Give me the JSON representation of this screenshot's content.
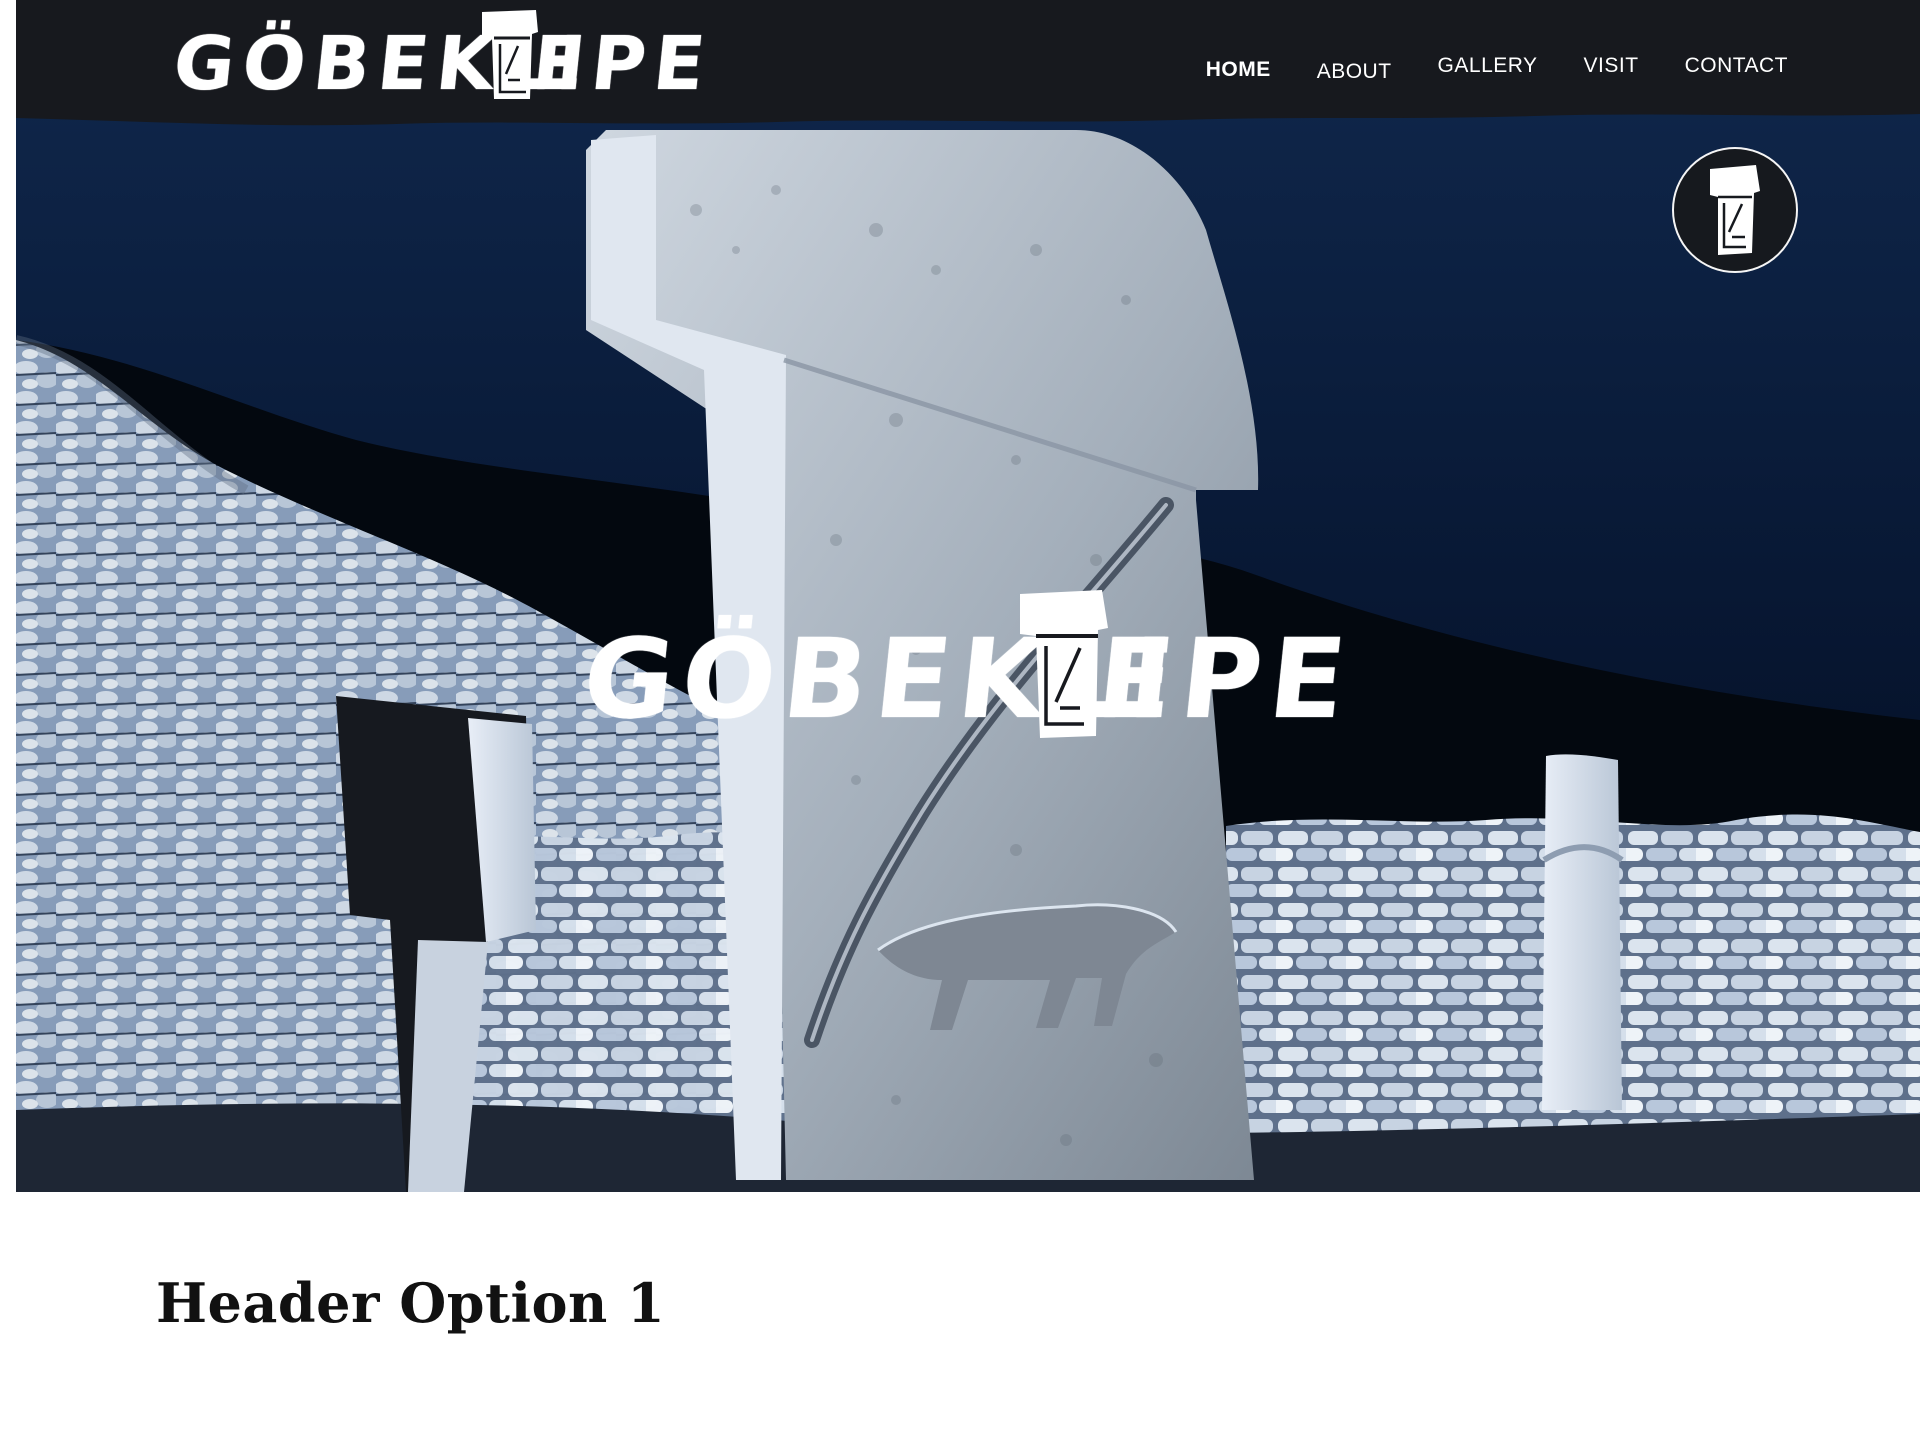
{
  "site": {
    "logo": {
      "word_left": "GÖBEKLI",
      "word_right": "EPE"
    }
  },
  "nav": {
    "items": [
      {
        "label": "HOME",
        "active": true
      },
      {
        "label": "ABOUT",
        "active": false
      },
      {
        "label": "GALLERY",
        "active": false
      },
      {
        "label": "VISIT",
        "active": false
      },
      {
        "label": "CONTACT",
        "active": false
      }
    ]
  },
  "hero": {
    "logo": {
      "word_left": "GÖBEKLI",
      "word_right": "EPE"
    }
  },
  "main": {
    "heading": "Header Option 1"
  },
  "colors": {
    "topbar": "#17191e",
    "sky": "#06152a",
    "stone": "#c9d3de",
    "text_dark": "#111111",
    "text_light": "#ffffff"
  },
  "icons": {
    "pillar": "t-pillar-logo-icon",
    "badge": "round-pillar-badge-icon"
  }
}
